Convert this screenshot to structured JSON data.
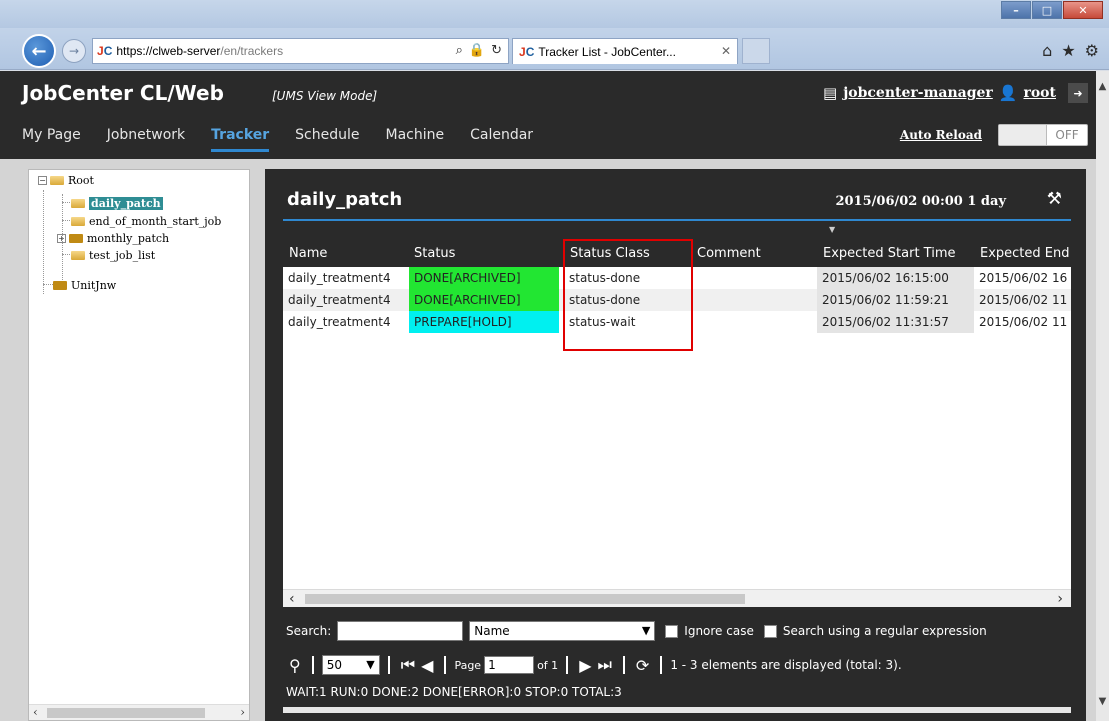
{
  "browser": {
    "url_host": "https://clweb-server",
    "url_path": "/en/trackers",
    "tab_title": "Tracker List - JobCenter...",
    "favicon_text_j": "J",
    "favicon_text_c": "C"
  },
  "app": {
    "title": "JobCenter CL/Web",
    "mode": "[UMS View Mode]",
    "server": "jobcenter-manager",
    "user": "root",
    "menu": [
      {
        "label": "My Page"
      },
      {
        "label": "Jobnetwork"
      },
      {
        "label": "Tracker"
      },
      {
        "label": "Schedule"
      },
      {
        "label": "Machine"
      },
      {
        "label": "Calendar"
      }
    ],
    "auto_reload": "Auto Reload",
    "toggle_state": "OFF"
  },
  "tree": {
    "root": "Root",
    "items": [
      "daily_patch",
      "end_of_month_start_job",
      "monthly_patch",
      "test_job_list"
    ],
    "other": "UnitJnw"
  },
  "panel": {
    "title": "daily_patch",
    "date": "2015/06/02 00:00 1 day",
    "columns": [
      "Name",
      "Status",
      "Status Class",
      "Comment",
      "Expected Start Time",
      "Expected End"
    ],
    "rows": [
      {
        "name": "daily_treatment4",
        "status": "DONE[ARCHIVED]",
        "status_color": "#22e632",
        "class": "status-done",
        "comment": "",
        "start": "2015/06/02 16:15:00",
        "end": "2015/06/02 16"
      },
      {
        "name": "daily_treatment4",
        "status": "DONE[ARCHIVED]",
        "status_color": "#22e632",
        "class": "status-done",
        "comment": "",
        "start": "2015/06/02 11:59:21",
        "end": "2015/06/02 11"
      },
      {
        "name": "daily_treatment4",
        "status": "PREPARE[HOLD]",
        "status_color": "#00f0f0",
        "class": "status-wait",
        "comment": "",
        "start": "2015/06/02 11:31:57",
        "end": "2015/06/02 11"
      }
    ],
    "search_label": "Search:",
    "search_value": "",
    "search_field": "Name",
    "ignore_case": "Ignore case",
    "regex": "Search using a regular expression",
    "page_size": "50",
    "page_label": "Page",
    "page_value": "1",
    "of_label": "of 1",
    "elements_info": "1 - 3 elements are displayed (total: 3).",
    "stats": "WAIT:1 RUN:0 DONE:2 DONE[ERROR]:0 STOP:0 TOTAL:3"
  }
}
